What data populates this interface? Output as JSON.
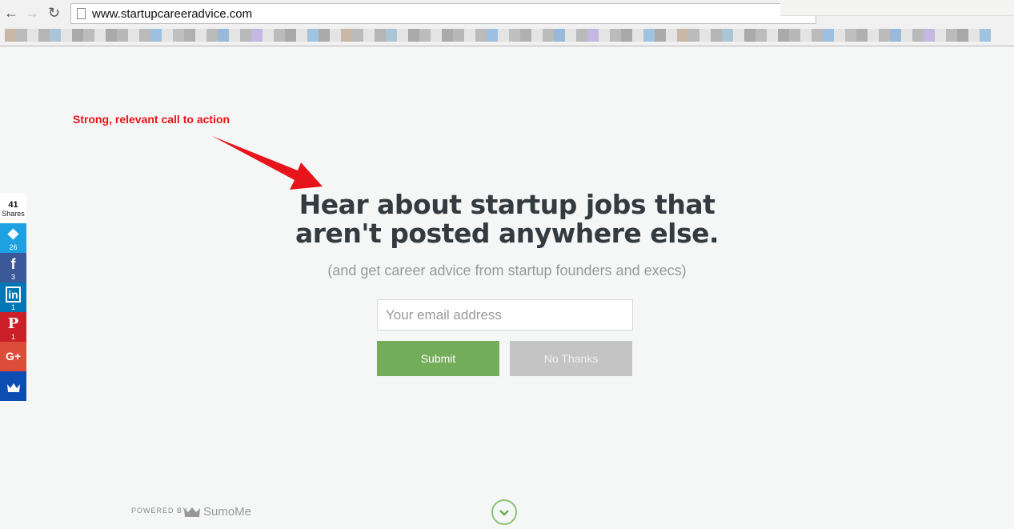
{
  "browser": {
    "url": "www.startupcareeradvice.com",
    "back_icon": "arrow-left-icon",
    "forward_icon": "arrow-right-icon",
    "reload_icon": "reload-icon"
  },
  "annotation": {
    "text": "Strong, relevant call to action",
    "color": "#e8141b"
  },
  "optin": {
    "headline_line1": "Hear about startup jobs that",
    "headline_line2": "aren't posted anywhere else.",
    "subheadline": "(and get career advice from startup founders and execs)",
    "email_placeholder": "Your email address",
    "submit_label": "Submit",
    "no_thanks_label": "No Thanks",
    "accent": "#74ad5a"
  },
  "share_bar": {
    "total": "41",
    "total_label": "Shares",
    "buttons": [
      {
        "network": "twitter",
        "icon": "twitter-icon",
        "count": "26",
        "color": "#1da1e2"
      },
      {
        "network": "facebook",
        "icon": "facebook-icon",
        "count": "3",
        "color": "#3b5998"
      },
      {
        "network": "linkedin",
        "icon": "linkedin-icon",
        "count": "1",
        "color": "#0077b5"
      },
      {
        "network": "pinterest",
        "icon": "pinterest-icon",
        "count": "1",
        "color": "#cb2027"
      },
      {
        "network": "google-plus",
        "icon": "google-plus-icon",
        "count": "",
        "color": "#dd4b39"
      },
      {
        "network": "sumome",
        "icon": "crown-icon",
        "count": "",
        "color": "#0d4db3"
      }
    ]
  },
  "footer": {
    "powered_by": "POWERED BY",
    "brand": "SumoMe"
  }
}
